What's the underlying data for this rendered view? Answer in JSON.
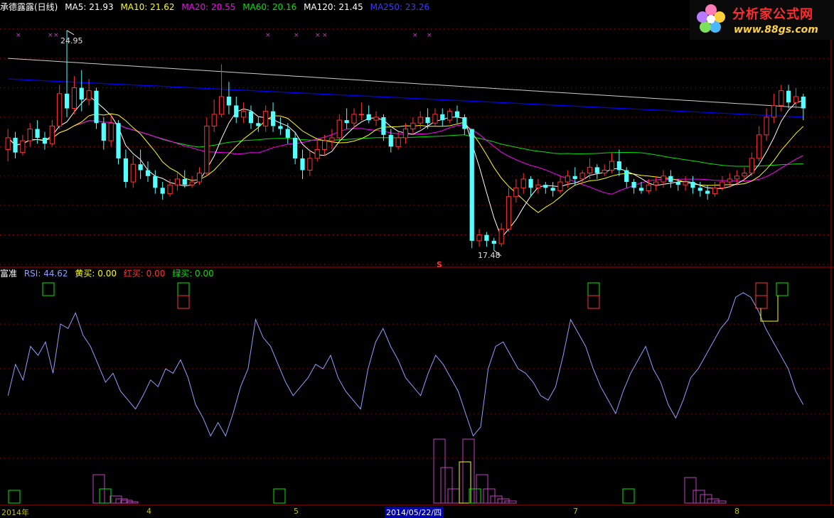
{
  "colors": {
    "background": "#000000",
    "axis_red": "#b00000",
    "candle_up": "#ff3232",
    "candle_down": "#54ffff",
    "ma5": "#ffffff",
    "ma10": "#ffff00",
    "ma20": "#ff00ff",
    "ma60": "#00e600",
    "ma120": "#ffffff",
    "ma250": "#0000ff",
    "rsi_line": "#8f9fff",
    "yellow_buy": "#ffff00",
    "red_buy": "#ff3232",
    "green_buy": "#00e600",
    "violet_bar": "#c040c0",
    "date_text": "#c0c000"
  },
  "main_header": {
    "title": "承德露露(日线)",
    "ma5": "MA5: 21.93",
    "ma10": "MA10: 21.62",
    "ma20": "MA20: 20.55",
    "ma60": "MA60: 20.16",
    "ma120": "MA120: 21.45",
    "ma250": "MA250: 23.26"
  },
  "indicator_header": {
    "name": "富准",
    "rsi": "RSI: 44.62",
    "yellow": "黄买: 0.00",
    "red": "红买: 0.00",
    "green": "绿买: 0.00"
  },
  "logo": {
    "title": "分析家公式网",
    "url": "www.88gs.com"
  },
  "annotations": {
    "high": "24.95",
    "low": "17.48",
    "signal_mark": "S"
  },
  "date_axis": [
    {
      "label": "2014年",
      "selected": false
    },
    {
      "label": "4",
      "selected": false
    },
    {
      "label": "5",
      "selected": false
    },
    {
      "label": "2014/05/22/四",
      "selected": true
    },
    {
      "label": "7",
      "selected": false
    },
    {
      "label": "8",
      "selected": false
    }
  ],
  "chart_data": {
    "type": "candlestick+line",
    "title": "承德露露(日线)",
    "ylim": [
      17.0,
      25.5
    ],
    "candles": [
      {
        "o": 20.9,
        "c": 21.3,
        "h": 21.6,
        "l": 20.5
      },
      {
        "o": 21.3,
        "c": 20.8,
        "h": 21.5,
        "l": 20.6
      },
      {
        "o": 20.8,
        "c": 21.2,
        "h": 21.4,
        "l": 20.7
      },
      {
        "o": 21.2,
        "c": 21.6,
        "h": 21.8,
        "l": 21.0
      },
      {
        "o": 21.6,
        "c": 21.3,
        "h": 21.9,
        "l": 21.1
      },
      {
        "o": 21.3,
        "c": 21.1,
        "h": 21.5,
        "l": 20.9
      },
      {
        "o": 21.1,
        "c": 21.7,
        "h": 21.9,
        "l": 21.0
      },
      {
        "o": 21.7,
        "c": 22.8,
        "h": 23.1,
        "l": 21.6
      },
      {
        "o": 22.8,
        "c": 22.3,
        "h": 24.95,
        "l": 22.0
      },
      {
        "o": 22.3,
        "c": 23.0,
        "h": 23.4,
        "l": 22.1
      },
      {
        "o": 23.0,
        "c": 22.6,
        "h": 23.6,
        "l": 22.2
      },
      {
        "o": 22.6,
        "c": 22.9,
        "h": 23.3,
        "l": 22.4
      },
      {
        "o": 22.9,
        "c": 21.8,
        "h": 23.0,
        "l": 21.6
      },
      {
        "o": 21.8,
        "c": 21.2,
        "h": 22.0,
        "l": 20.9
      },
      {
        "o": 21.2,
        "c": 21.8,
        "h": 22.1,
        "l": 21.0
      },
      {
        "o": 21.8,
        "c": 20.6,
        "h": 21.9,
        "l": 20.4
      },
      {
        "o": 20.6,
        "c": 19.8,
        "h": 20.9,
        "l": 19.6
      },
      {
        "o": 19.8,
        "c": 20.4,
        "h": 20.7,
        "l": 19.6
      },
      {
        "o": 20.4,
        "c": 20.2,
        "h": 20.9,
        "l": 19.9
      },
      {
        "o": 20.2,
        "c": 20.0,
        "h": 20.5,
        "l": 19.8
      },
      {
        "o": 20.0,
        "c": 19.6,
        "h": 20.2,
        "l": 19.4
      },
      {
        "o": 19.6,
        "c": 19.4,
        "h": 19.8,
        "l": 19.2
      },
      {
        "o": 19.4,
        "c": 19.7,
        "h": 19.9,
        "l": 19.3
      },
      {
        "o": 19.7,
        "c": 19.9,
        "h": 20.1,
        "l": 19.5
      },
      {
        "o": 19.9,
        "c": 19.7,
        "h": 20.2,
        "l": 19.6
      },
      {
        "o": 19.7,
        "c": 19.8,
        "h": 20.0,
        "l": 19.6
      },
      {
        "o": 19.8,
        "c": 20.1,
        "h": 20.3,
        "l": 19.7
      },
      {
        "o": 20.1,
        "c": 21.7,
        "h": 22.0,
        "l": 20.0
      },
      {
        "o": 21.7,
        "c": 22.1,
        "h": 22.6,
        "l": 21.5
      },
      {
        "o": 22.1,
        "c": 22.7,
        "h": 23.8,
        "l": 22.0
      },
      {
        "o": 22.7,
        "c": 22.4,
        "h": 23.2,
        "l": 22.1
      },
      {
        "o": 22.4,
        "c": 22.0,
        "h": 22.7,
        "l": 21.8
      },
      {
        "o": 22.0,
        "c": 22.2,
        "h": 22.5,
        "l": 21.8
      },
      {
        "o": 22.2,
        "c": 21.8,
        "h": 22.4,
        "l": 21.6
      },
      {
        "o": 21.8,
        "c": 21.7,
        "h": 22.0,
        "l": 21.5
      },
      {
        "o": 21.7,
        "c": 22.2,
        "h": 22.4,
        "l": 21.5
      },
      {
        "o": 22.2,
        "c": 21.7,
        "h": 22.5,
        "l": 21.5
      },
      {
        "o": 21.7,
        "c": 21.6,
        "h": 22.0,
        "l": 21.4
      },
      {
        "o": 21.6,
        "c": 21.3,
        "h": 21.8,
        "l": 21.1
      },
      {
        "o": 21.3,
        "c": 20.6,
        "h": 21.5,
        "l": 20.4
      },
      {
        "o": 20.6,
        "c": 20.2,
        "h": 20.9,
        "l": 19.9
      },
      {
        "o": 20.2,
        "c": 20.6,
        "h": 20.9,
        "l": 20.0
      },
      {
        "o": 20.6,
        "c": 20.9,
        "h": 21.2,
        "l": 20.5
      },
      {
        "o": 20.9,
        "c": 21.2,
        "h": 21.4,
        "l": 20.7
      },
      {
        "o": 21.2,
        "c": 21.3,
        "h": 21.6,
        "l": 20.9
      },
      {
        "o": 21.3,
        "c": 21.9,
        "h": 22.1,
        "l": 21.2
      },
      {
        "o": 21.9,
        "c": 21.8,
        "h": 22.3,
        "l": 21.6
      },
      {
        "o": 21.8,
        "c": 22.1,
        "h": 22.3,
        "l": 21.6
      },
      {
        "o": 22.1,
        "c": 22.1,
        "h": 22.5,
        "l": 21.9
      },
      {
        "o": 22.1,
        "c": 21.9,
        "h": 22.4,
        "l": 21.8
      },
      {
        "o": 21.9,
        "c": 22.0,
        "h": 22.2,
        "l": 21.7
      },
      {
        "o": 22.0,
        "c": 21.4,
        "h": 22.1,
        "l": 21.2
      },
      {
        "o": 21.4,
        "c": 21.0,
        "h": 21.6,
        "l": 20.8
      },
      {
        "o": 21.0,
        "c": 21.3,
        "h": 21.5,
        "l": 20.9
      },
      {
        "o": 21.3,
        "c": 21.6,
        "h": 21.8,
        "l": 21.1
      },
      {
        "o": 21.6,
        "c": 21.8,
        "h": 22.0,
        "l": 21.4
      },
      {
        "o": 21.8,
        "c": 22.0,
        "h": 22.2,
        "l": 21.6
      },
      {
        "o": 22.0,
        "c": 21.8,
        "h": 22.3,
        "l": 21.6
      },
      {
        "o": 21.8,
        "c": 22.1,
        "h": 22.3,
        "l": 21.7
      },
      {
        "o": 22.1,
        "c": 21.9,
        "h": 22.3,
        "l": 21.7
      },
      {
        "o": 21.9,
        "c": 22.2,
        "h": 22.3,
        "l": 21.8
      },
      {
        "o": 22.2,
        "c": 22.0,
        "h": 22.4,
        "l": 21.8
      },
      {
        "o": 22.0,
        "c": 21.6,
        "h": 22.1,
        "l": 21.4
      },
      {
        "o": 21.6,
        "c": 17.8,
        "h": 18.1,
        "l": 17.55
      },
      {
        "o": 17.8,
        "c": 18.0,
        "h": 18.2,
        "l": 17.6
      },
      {
        "o": 18.0,
        "c": 17.8,
        "h": 18.1,
        "l": 17.6
      },
      {
        "o": 17.8,
        "c": 17.7,
        "h": 17.9,
        "l": 17.48
      },
      {
        "o": 17.7,
        "c": 18.2,
        "h": 18.4,
        "l": 17.6
      },
      {
        "o": 18.2,
        "c": 19.3,
        "h": 19.6,
        "l": 18.1
      },
      {
        "o": 19.3,
        "c": 19.6,
        "h": 19.9,
        "l": 19.1
      },
      {
        "o": 19.6,
        "c": 19.9,
        "h": 20.1,
        "l": 19.4
      },
      {
        "o": 19.9,
        "c": 19.6,
        "h": 20.0,
        "l": 19.3
      },
      {
        "o": 19.6,
        "c": 19.7,
        "h": 19.9,
        "l": 19.4
      },
      {
        "o": 19.7,
        "c": 19.6,
        "h": 19.8,
        "l": 19.4
      },
      {
        "o": 19.6,
        "c": 19.5,
        "h": 19.8,
        "l": 19.3
      },
      {
        "o": 19.5,
        "c": 19.8,
        "h": 20.0,
        "l": 19.4
      },
      {
        "o": 19.8,
        "c": 20.0,
        "h": 20.2,
        "l": 19.6
      },
      {
        "o": 20.0,
        "c": 19.9,
        "h": 20.3,
        "l": 19.7
      },
      {
        "o": 19.9,
        "c": 20.1,
        "h": 20.2,
        "l": 19.7
      },
      {
        "o": 20.1,
        "c": 20.3,
        "h": 20.6,
        "l": 19.9
      },
      {
        "o": 20.3,
        "c": 20.1,
        "h": 20.4,
        "l": 19.9
      },
      {
        "o": 20.1,
        "c": 20.2,
        "h": 20.4,
        "l": 20.0
      },
      {
        "o": 20.2,
        "c": 20.5,
        "h": 20.8,
        "l": 20.1
      },
      {
        "o": 20.5,
        "c": 20.2,
        "h": 20.9,
        "l": 20.0
      },
      {
        "o": 20.2,
        "c": 19.8,
        "h": 20.3,
        "l": 19.6
      },
      {
        "o": 19.8,
        "c": 19.6,
        "h": 19.9,
        "l": 19.4
      },
      {
        "o": 19.6,
        "c": 19.5,
        "h": 19.8,
        "l": 19.4
      },
      {
        "o": 19.5,
        "c": 19.7,
        "h": 19.9,
        "l": 19.4
      },
      {
        "o": 19.7,
        "c": 19.8,
        "h": 20.0,
        "l": 19.5
      },
      {
        "o": 19.8,
        "c": 20.0,
        "h": 20.2,
        "l": 19.6
      },
      {
        "o": 20.0,
        "c": 19.8,
        "h": 20.2,
        "l": 19.6
      },
      {
        "o": 19.8,
        "c": 19.7,
        "h": 19.9,
        "l": 19.5
      },
      {
        "o": 19.7,
        "c": 19.8,
        "h": 20.0,
        "l": 19.5
      },
      {
        "o": 19.8,
        "c": 19.6,
        "h": 20.0,
        "l": 19.4
      },
      {
        "o": 19.6,
        "c": 19.5,
        "h": 19.8,
        "l": 19.3
      },
      {
        "o": 19.5,
        "c": 19.4,
        "h": 19.7,
        "l": 19.2
      },
      {
        "o": 19.4,
        "c": 19.6,
        "h": 19.8,
        "l": 19.3
      },
      {
        "o": 19.6,
        "c": 19.8,
        "h": 20.0,
        "l": 19.5
      },
      {
        "o": 19.8,
        "c": 19.9,
        "h": 20.1,
        "l": 19.6
      },
      {
        "o": 19.9,
        "c": 20.0,
        "h": 20.2,
        "l": 19.7
      },
      {
        "o": 20.0,
        "c": 20.1,
        "h": 20.3,
        "l": 19.8
      },
      {
        "o": 20.1,
        "c": 20.6,
        "h": 20.8,
        "l": 20.0
      },
      {
        "o": 20.6,
        "c": 21.4,
        "h": 21.7,
        "l": 20.5
      },
      {
        "o": 21.4,
        "c": 22.0,
        "h": 22.3,
        "l": 21.2
      },
      {
        "o": 22.0,
        "c": 22.4,
        "h": 22.8,
        "l": 21.8
      },
      {
        "o": 22.4,
        "c": 22.9,
        "h": 23.1,
        "l": 22.2
      },
      {
        "o": 22.9,
        "c": 22.5,
        "h": 23.1,
        "l": 22.3
      },
      {
        "o": 22.5,
        "c": 22.7,
        "h": 23.0,
        "l": 22.3
      },
      {
        "o": 22.7,
        "c": 22.3,
        "h": 22.8,
        "l": 21.9
      }
    ],
    "rsi": [
      48,
      62,
      55,
      70,
      66,
      72,
      58,
      80,
      78,
      85,
      75,
      70,
      62,
      54,
      58,
      50,
      46,
      42,
      48,
      55,
      52,
      60,
      58,
      64,
      56,
      44,
      38,
      30,
      36,
      30,
      40,
      52,
      60,
      82,
      74,
      70,
      62,
      54,
      48,
      52,
      56,
      62,
      60,
      66,
      56,
      50,
      46,
      42,
      60,
      72,
      78,
      70,
      64,
      56,
      52,
      48,
      58,
      66,
      62,
      56,
      50,
      40,
      30,
      34,
      60,
      70,
      72,
      66,
      60,
      58,
      54,
      48,
      46,
      52,
      66,
      82,
      76,
      70,
      60,
      52,
      46,
      40,
      50,
      58,
      64,
      70,
      60,
      54,
      44,
      38,
      46,
      56,
      60,
      66,
      72,
      78,
      82,
      92,
      94,
      92,
      86,
      78,
      72,
      66,
      60,
      50,
      44
    ]
  }
}
